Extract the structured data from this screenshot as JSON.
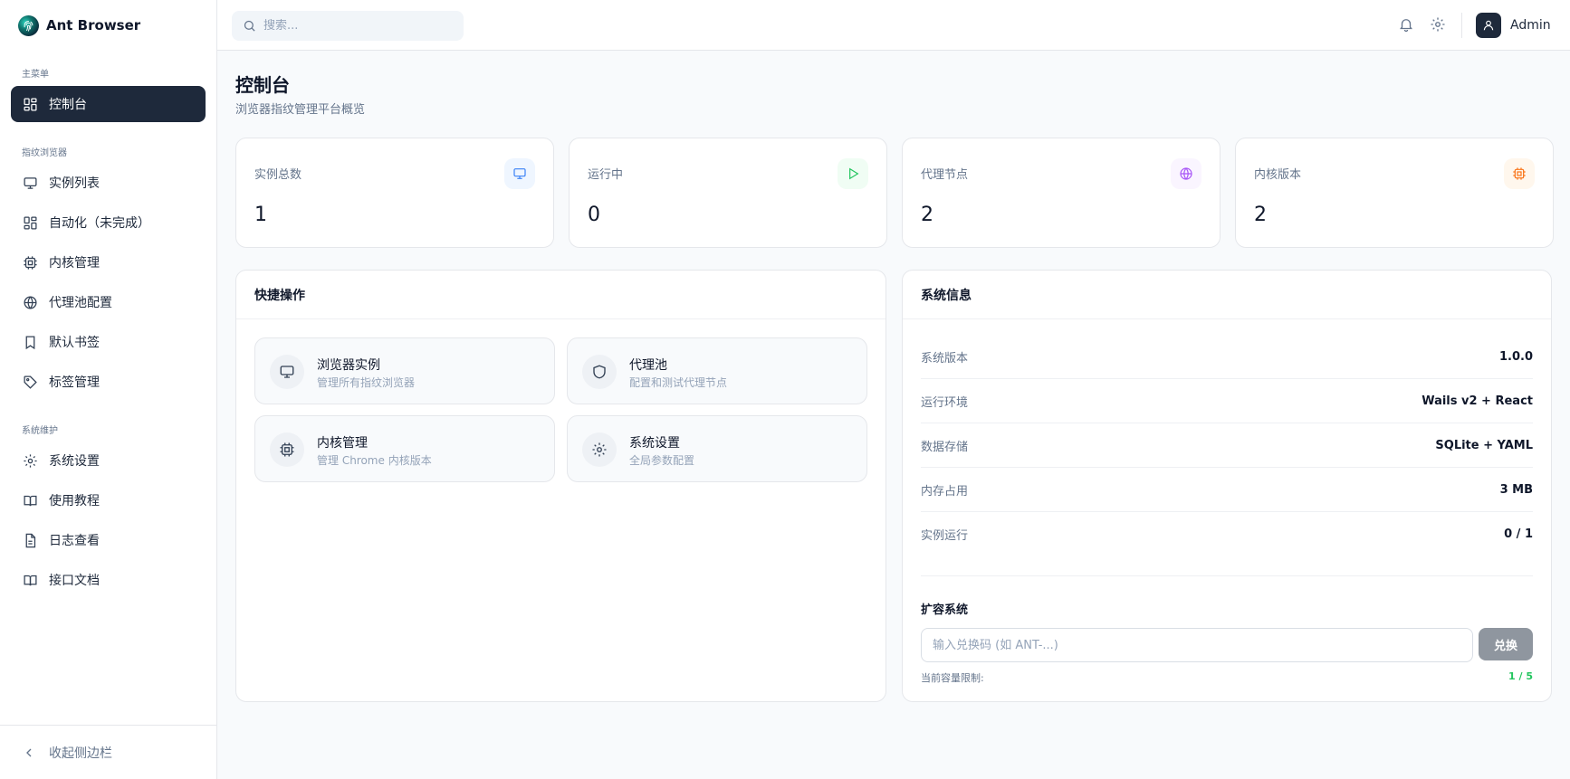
{
  "app": {
    "name": "Ant Browser"
  },
  "sidebar": {
    "sections": [
      {
        "title": "主菜单",
        "items": [
          {
            "label": "控制台",
            "icon": "dashboard-icon",
            "active": true
          }
        ]
      },
      {
        "title": "指纹浏览器",
        "items": [
          {
            "label": "实例列表",
            "icon": "monitor-icon"
          },
          {
            "label": "自动化（未完成）",
            "icon": "grid-icon"
          },
          {
            "label": "内核管理",
            "icon": "cpu-icon"
          },
          {
            "label": "代理池配置",
            "icon": "globe-icon"
          },
          {
            "label": "默认书签",
            "icon": "bookmark-icon"
          },
          {
            "label": "标签管理",
            "icon": "tag-icon"
          }
        ]
      },
      {
        "title": "系统维护",
        "items": [
          {
            "label": "系统设置",
            "icon": "gear-icon"
          },
          {
            "label": "使用教程",
            "icon": "book-icon"
          },
          {
            "label": "日志查看",
            "icon": "file-text-icon"
          },
          {
            "label": "接口文档",
            "icon": "book-icon"
          }
        ]
      }
    ],
    "collapse_label": "收起侧边栏"
  },
  "topbar": {
    "search_placeholder": "搜索...",
    "user_name": "Admin"
  },
  "page": {
    "title": "控制台",
    "subtitle": "浏览器指纹管理平台概览"
  },
  "stats": [
    {
      "label": "实例总数",
      "value": "1",
      "icon": "monitor-icon",
      "color": "#3b82f6"
    },
    {
      "label": "运行中",
      "value": "0",
      "icon": "play-icon",
      "color": "#22c55e"
    },
    {
      "label": "代理节点",
      "value": "2",
      "icon": "globe-icon",
      "color": "#a855f7"
    },
    {
      "label": "内核版本",
      "value": "2",
      "icon": "cpu-icon",
      "color": "#f97316"
    }
  ],
  "quick_actions": {
    "title": "快捷操作",
    "items": [
      {
        "title": "浏览器实例",
        "desc": "管理所有指纹浏览器",
        "icon": "monitor-icon"
      },
      {
        "title": "代理池",
        "desc": "配置和测试代理节点",
        "icon": "shield-icon"
      },
      {
        "title": "内核管理",
        "desc": "管理 Chrome 内核版本",
        "icon": "cpu-icon"
      },
      {
        "title": "系统设置",
        "desc": "全局参数配置",
        "icon": "gear-icon"
      }
    ]
  },
  "system_info": {
    "title": "系统信息",
    "rows": [
      {
        "label": "系统版本",
        "value": "1.0.0"
      },
      {
        "label": "运行环境",
        "value": "Wails v2 + React"
      },
      {
        "label": "数据存储",
        "value": "SQLite + YAML"
      },
      {
        "label": "内存占用",
        "value": "3 MB"
      },
      {
        "label": "实例运行",
        "value": "0 / 1"
      }
    ],
    "expand": {
      "title": "扩容系统",
      "input_placeholder": "输入兑换码 (如 ANT-...)",
      "button_label": "兑换",
      "capacity_label": "当前容量限制:",
      "capacity_value": "1 / 5"
    }
  },
  "colors": {
    "sidebar_active_bg": "#1e293b",
    "page_bg": "#f8fafc",
    "capacity_green": "#22c55e"
  }
}
